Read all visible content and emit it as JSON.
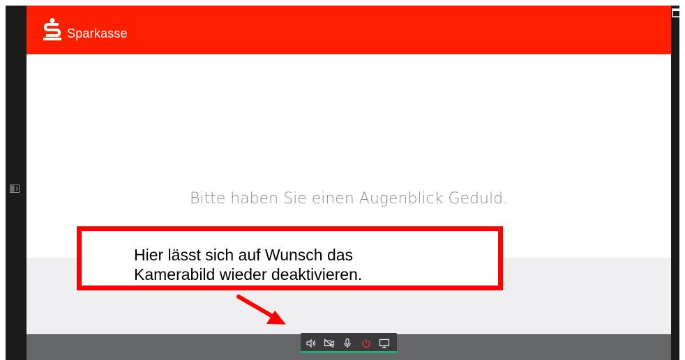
{
  "header": {
    "brand": "Sparkasse",
    "brand_color": "#fe1f00",
    "logo_icon": "sparkasse-s-logo"
  },
  "main": {
    "wait_message": "Bitte haben Sie einen Augenblick Geduld."
  },
  "callout": {
    "line1": "Hier lässt sich auf Wunsch das",
    "line2": "Kamerabild wieder deaktivieren.",
    "border_color": "#ff0000"
  },
  "controls": {
    "items": [
      {
        "icon": "speaker-icon"
      },
      {
        "icon": "camera-off-icon"
      },
      {
        "icon": "microphone-icon"
      },
      {
        "icon": "power-icon",
        "color": "#e53935"
      },
      {
        "icon": "screen-share-icon"
      }
    ],
    "underline_color": "#20b07a"
  },
  "side_icons": {
    "left": "sidebar-toggle-icon",
    "top_right": "window-icon"
  }
}
